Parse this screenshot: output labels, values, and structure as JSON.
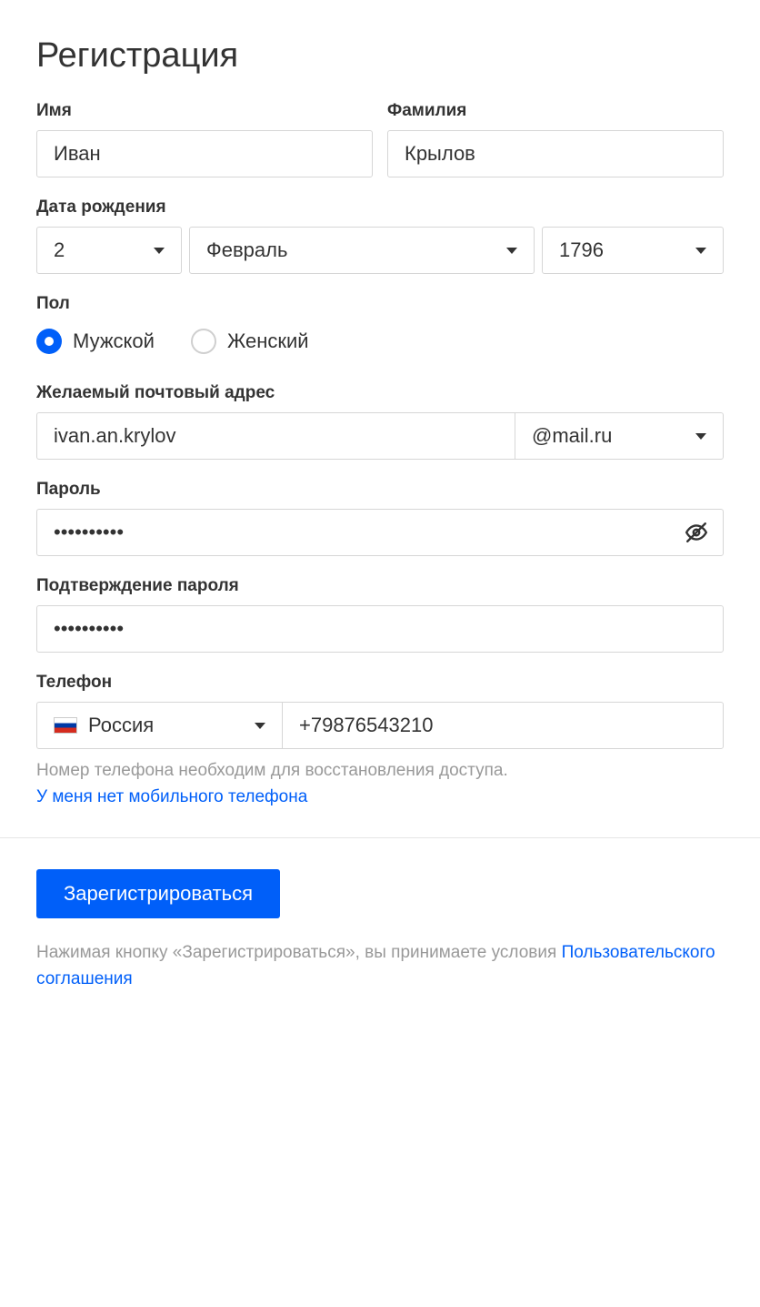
{
  "title": "Регистрация",
  "name": {
    "label": "Имя",
    "value": "Иван"
  },
  "surname": {
    "label": "Фамилия",
    "value": "Крылов"
  },
  "dob": {
    "label": "Дата рождения",
    "day": "2",
    "month": "Февраль",
    "year": "1796"
  },
  "gender": {
    "label": "Пол",
    "male": "Мужской",
    "female": "Женский",
    "selected": "male"
  },
  "email": {
    "label": "Желаемый почтовый адрес",
    "value": "ivan.an.krylov",
    "domain": "@mail.ru"
  },
  "password": {
    "label": "Пароль",
    "value": "••••••••••"
  },
  "password_confirm": {
    "label": "Подтверждение пароля",
    "value": "••••••••••"
  },
  "phone": {
    "label": "Телефон",
    "country": "Россия",
    "value": "+79876543210",
    "hint": "Номер телефона необходим для восстановления доступа.",
    "no_phone_link": "У меня нет мобильного телефона"
  },
  "submit": "Зарегистрироваться",
  "terms": {
    "prefix": "Нажимая кнопку «Зарегистрироваться», вы принимаете условия ",
    "link": "Пользовательского соглашения"
  }
}
